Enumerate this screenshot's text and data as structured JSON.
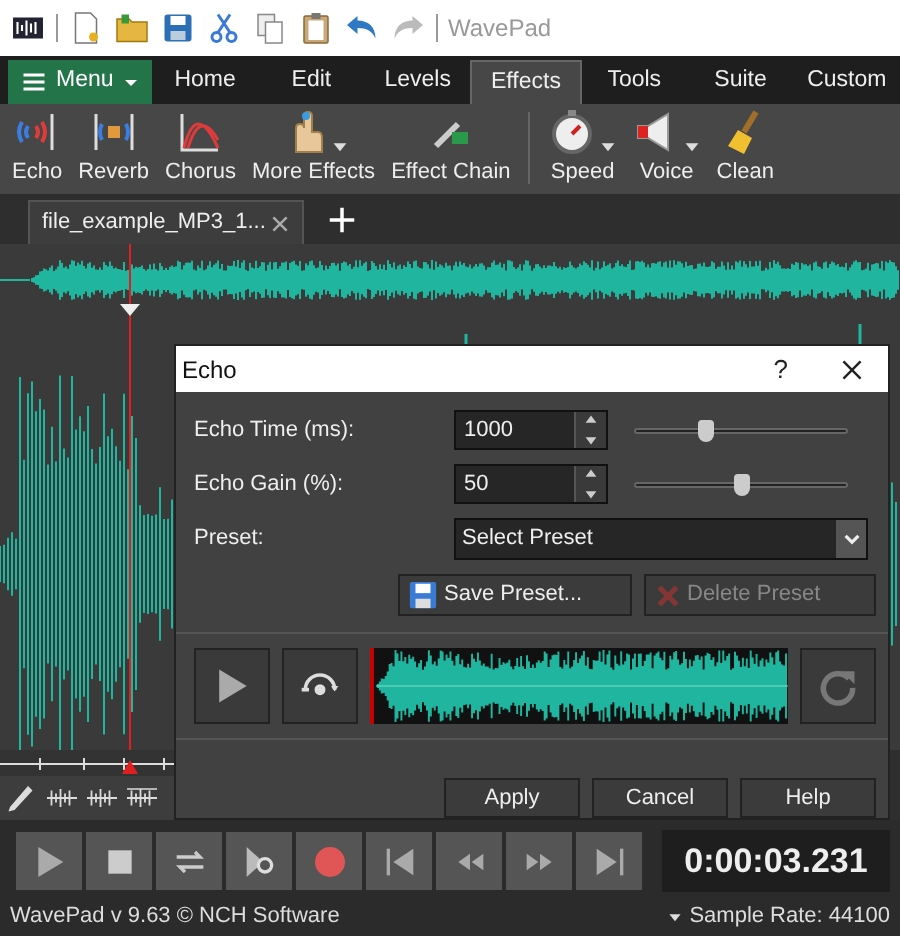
{
  "title_bar": {
    "app_name": "WavePad"
  },
  "ribbon_tabs": [
    {
      "label": "Menu",
      "kind": "menu",
      "selected": false
    },
    {
      "label": "Home",
      "kind": "tab",
      "selected": false
    },
    {
      "label": "Edit",
      "kind": "tab",
      "selected": false
    },
    {
      "label": "Levels",
      "kind": "tab",
      "selected": false
    },
    {
      "label": "Effects",
      "kind": "tab",
      "selected": true
    },
    {
      "label": "Tools",
      "kind": "tab",
      "selected": false
    },
    {
      "label": "Suite",
      "kind": "tab",
      "selected": false
    },
    {
      "label": "Custom",
      "kind": "tab",
      "selected": false
    }
  ],
  "ribbon_groups": [
    [
      {
        "label": "Echo",
        "kind": "echo",
        "dropdown": false
      },
      {
        "label": "Reverb",
        "kind": "reverb",
        "dropdown": false
      },
      {
        "label": "Chorus",
        "kind": "chorus",
        "dropdown": false
      },
      {
        "label": "More Effects",
        "kind": "hand",
        "dropdown": true
      },
      {
        "label": "Effect Chain",
        "kind": "chain",
        "dropdown": false
      }
    ],
    [
      {
        "label": "Speed",
        "kind": "speed",
        "dropdown": true
      },
      {
        "label": "Voice",
        "kind": "voice",
        "dropdown": true
      },
      {
        "label": "Clean",
        "kind": "clean",
        "dropdown": false
      }
    ]
  ],
  "file_tabs": [
    {
      "label": "file_example_MP3_1...",
      "selected": true
    }
  ],
  "dialog": {
    "title": "Echo",
    "help": "?",
    "fields": [
      {
        "label": "Echo Time (ms):",
        "value": "1000",
        "level": 0.33
      },
      {
        "label": "Echo Gain (%):",
        "value": "50",
        "level": 0.5
      }
    ],
    "preset": {
      "label": "Preset:",
      "value": "Select Preset"
    },
    "preset_buttons": [
      {
        "label": "Save Preset...",
        "kind": "save",
        "disabled": false
      },
      {
        "label": "Delete Preset",
        "kind": "delete",
        "disabled": true
      }
    ],
    "actions": [
      "Apply",
      "Cancel",
      "Help"
    ]
  },
  "transport": {
    "time": "0:00:03.231"
  },
  "status_bar": {
    "left": "WavePad v 9.63 © NCH Software",
    "right": "Sample Rate: 44100"
  }
}
